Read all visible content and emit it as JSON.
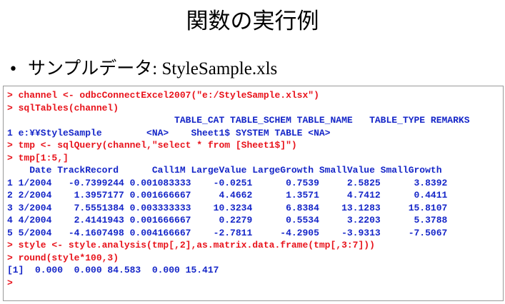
{
  "slide": {
    "title": "関数の実行例",
    "bullet": {
      "symbol": "•",
      "label": "サンプルデータ",
      "filename": ": StyleSample.xls"
    }
  },
  "colors": {
    "command": "#e8131b",
    "output": "#1526c8",
    "text": "#000000",
    "border": "#9a9a9a"
  },
  "console": {
    "lines": [
      {
        "kind": "cmd",
        "text": "> channel <- odbcConnectExcel2007(\"e:/StyleSample.xlsx\")"
      },
      {
        "kind": "cmd",
        "text": "> sqlTables(channel)"
      },
      {
        "kind": "out",
        "text": "                              TABLE_CAT TABLE_SCHEM TABLE_NAME   TABLE_TYPE REMARKS"
      },
      {
        "kind": "out",
        "text": "1 e:¥¥StyleSample        <NA>    Sheet1$ SYSTEM TABLE <NA>"
      },
      {
        "kind": "cmd",
        "text": "> tmp <- sqlQuery(channel,\"select * from [Sheet1$]\")"
      },
      {
        "kind": "cmd",
        "text": "> tmp[1:5,]"
      },
      {
        "kind": "out",
        "text": "    Date TrackRecord      Call1M LargeValue LargeGrowth SmallValue SmallGrowth"
      },
      {
        "kind": "out",
        "text": "1 1/2004   -0.7399244 0.001083333    -0.0251      0.7539     2.5825      3.8392"
      },
      {
        "kind": "out",
        "text": "2 2/2004    1.3957177 0.001666667     4.4662      1.3571     4.7412      0.4411"
      },
      {
        "kind": "out",
        "text": "3 3/2004    7.5551384 0.003333333    10.3234      6.8384    13.1283     15.8107"
      },
      {
        "kind": "out",
        "text": "4 4/2004    2.4141943 0.001666667     0.2279      0.5534     3.2203      5.3788"
      },
      {
        "kind": "out",
        "text": "5 5/2004   -4.1607498 0.004166667    -2.7811     -4.2905    -3.9313     -7.5067"
      },
      {
        "kind": "cmd",
        "text": "> style <- style.analysis(tmp[,2],as.matrix.data.frame(tmp[,3:7]))"
      },
      {
        "kind": "cmd",
        "text": "> round(style*100,3)"
      },
      {
        "kind": "out",
        "text": "[1]  0.000  0.000 84.583  0.000 15.417"
      },
      {
        "kind": "cmd",
        "text": ">"
      }
    ]
  }
}
